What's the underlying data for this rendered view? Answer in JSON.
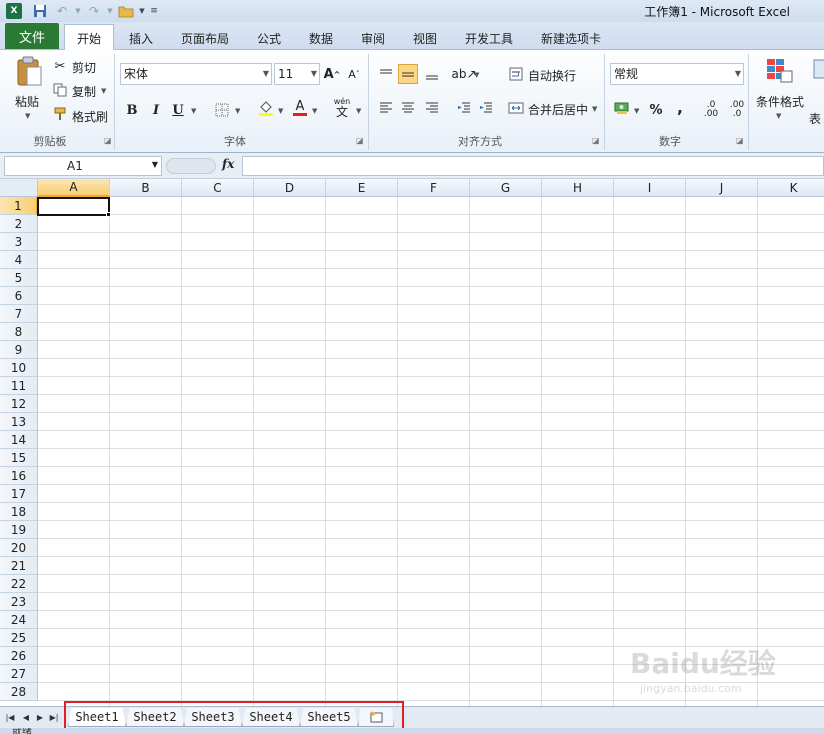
{
  "window": {
    "title": "工作簿1 - Microsoft Excel"
  },
  "ribbon_tabs": [
    {
      "label": "文件"
    },
    {
      "label": "开始"
    },
    {
      "label": "插入"
    },
    {
      "label": "页面布局"
    },
    {
      "label": "公式"
    },
    {
      "label": "数据"
    },
    {
      "label": "审阅"
    },
    {
      "label": "视图"
    },
    {
      "label": "开发工具"
    },
    {
      "label": "新建选项卡"
    }
  ],
  "clipboard": {
    "paste": "粘贴",
    "cut": "剪切",
    "copy": "复制",
    "format_painter": "格式刷",
    "group": "剪贴板"
  },
  "font": {
    "name": "宋体",
    "size": "11",
    "bold": "B",
    "italic": "I",
    "underline": "U",
    "group": "字体",
    "wen": "wén",
    "wen_char": "文"
  },
  "alignment": {
    "wrap": "自动换行",
    "merge": "合并后居中",
    "group": "对齐方式"
  },
  "number": {
    "format": "常规",
    "percent": "%",
    "comma": ",",
    "inc_decimal": ".0 .00",
    "dec_decimal": ".00 .0",
    "group": "数字"
  },
  "styles": {
    "conditional": "条件格式",
    "table_partial": "表"
  },
  "formula_bar": {
    "name_box": "A1",
    "fx": "fx",
    "value": ""
  },
  "columns": [
    "A",
    "B",
    "C",
    "D",
    "E",
    "F",
    "G",
    "H",
    "I",
    "J",
    "K"
  ],
  "rows": [
    "1",
    "2",
    "3",
    "4",
    "5",
    "6",
    "7",
    "8",
    "9",
    "10",
    "11",
    "12",
    "13",
    "14",
    "15",
    "16",
    "17",
    "18",
    "19",
    "20",
    "21",
    "22",
    "23",
    "24",
    "25",
    "26",
    "27",
    "28"
  ],
  "selected_cell": "A1",
  "sheets": [
    "Sheet1",
    "Sheet2",
    "Sheet3",
    "Sheet4",
    "Sheet5"
  ],
  "active_sheet": "Sheet1",
  "status": {
    "text": "就绪"
  },
  "watermark": {
    "main": "Baidu经验",
    "sub": "jingyan.baidu.com"
  },
  "colors": {
    "file_tab": "#2a7a36",
    "selection_header": "#f7cf72",
    "highlight_box": "#e02020"
  }
}
